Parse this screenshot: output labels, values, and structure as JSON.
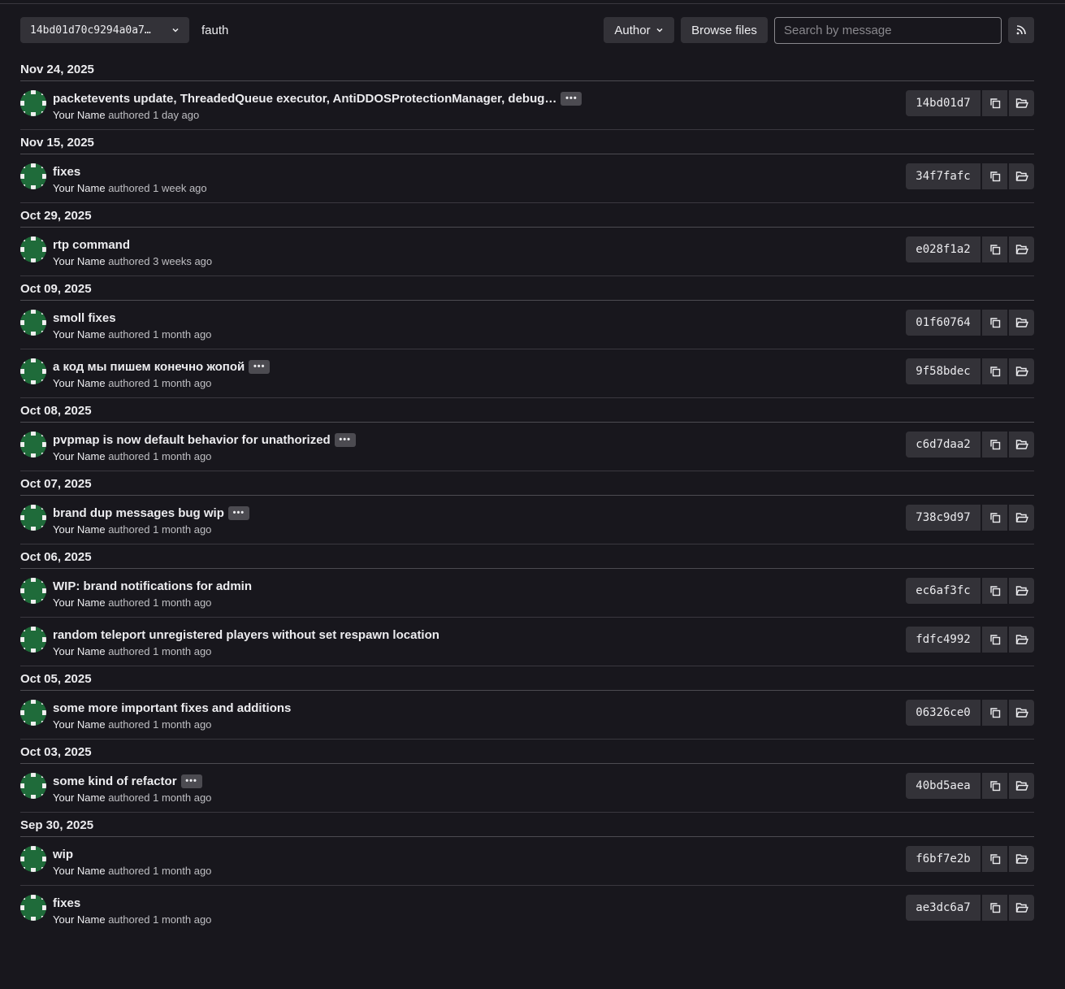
{
  "toolbar": {
    "ref_value": "14bd01d70c9294a0a7…",
    "path": "fauth",
    "author_label": "Author",
    "browse_label": "Browse files",
    "search_placeholder": "Search by message"
  },
  "colors": {
    "background": "#18171d",
    "button": "#333238",
    "avatar_green": "#1f6b3a"
  },
  "days": [
    {
      "date": "Nov 24, 2025",
      "commits": [
        {
          "message": "packetevents update, ThreadedQueue executor, AntiDDOSProtectionManager, debug…",
          "has_more": true,
          "author": "Your Name",
          "authored": "authored",
          "time": "1 day ago",
          "sha": "14bd01d7"
        }
      ]
    },
    {
      "date": "Nov 15, 2025",
      "commits": [
        {
          "message": "fixes",
          "has_more": false,
          "author": "Your Name",
          "authored": "authored",
          "time": "1 week ago",
          "sha": "34f7fafc"
        }
      ]
    },
    {
      "date": "Oct 29, 2025",
      "commits": [
        {
          "message": "rtp command",
          "has_more": false,
          "author": "Your Name",
          "authored": "authored",
          "time": "3 weeks ago",
          "sha": "e028f1a2"
        }
      ]
    },
    {
      "date": "Oct 09, 2025",
      "commits": [
        {
          "message": "smoll fixes",
          "has_more": false,
          "author": "Your Name",
          "authored": "authored",
          "time": "1 month ago",
          "sha": "01f60764"
        },
        {
          "message": "а код мы пишем конечно жопой",
          "has_more": true,
          "author": "Your Name",
          "authored": "authored",
          "time": "1 month ago",
          "sha": "9f58bdec"
        }
      ]
    },
    {
      "date": "Oct 08, 2025",
      "commits": [
        {
          "message": "pvpmap is now default behavior for unathorized",
          "has_more": true,
          "author": "Your Name",
          "authored": "authored",
          "time": "1 month ago",
          "sha": "c6d7daa2"
        }
      ]
    },
    {
      "date": "Oct 07, 2025",
      "commits": [
        {
          "message": "brand dup messages bug wip",
          "has_more": true,
          "author": "Your Name",
          "authored": "authored",
          "time": "1 month ago",
          "sha": "738c9d97"
        }
      ]
    },
    {
      "date": "Oct 06, 2025",
      "commits": [
        {
          "message": "WIP: brand notifications for admin",
          "has_more": false,
          "author": "Your Name",
          "authored": "authored",
          "time": "1 month ago",
          "sha": "ec6af3fc"
        },
        {
          "message": "random teleport unregistered players without set respawn location",
          "has_more": false,
          "author": "Your Name",
          "authored": "authored",
          "time": "1 month ago",
          "sha": "fdfc4992"
        }
      ]
    },
    {
      "date": "Oct 05, 2025",
      "commits": [
        {
          "message": "some more important fixes and additions",
          "has_more": false,
          "author": "Your Name",
          "authored": "authored",
          "time": "1 month ago",
          "sha": "06326ce0"
        }
      ]
    },
    {
      "date": "Oct 03, 2025",
      "commits": [
        {
          "message": "some kind of refactor",
          "has_more": true,
          "author": "Your Name",
          "authored": "authored",
          "time": "1 month ago",
          "sha": "40bd5aea"
        }
      ]
    },
    {
      "date": "Sep 30, 2025",
      "commits": [
        {
          "message": "wip",
          "has_more": false,
          "author": "Your Name",
          "authored": "authored",
          "time": "1 month ago",
          "sha": "f6bf7e2b"
        },
        {
          "message": "fixes",
          "has_more": false,
          "author": "Your Name",
          "authored": "authored",
          "time": "1 month ago",
          "sha": "ae3dc6a7"
        }
      ]
    }
  ]
}
